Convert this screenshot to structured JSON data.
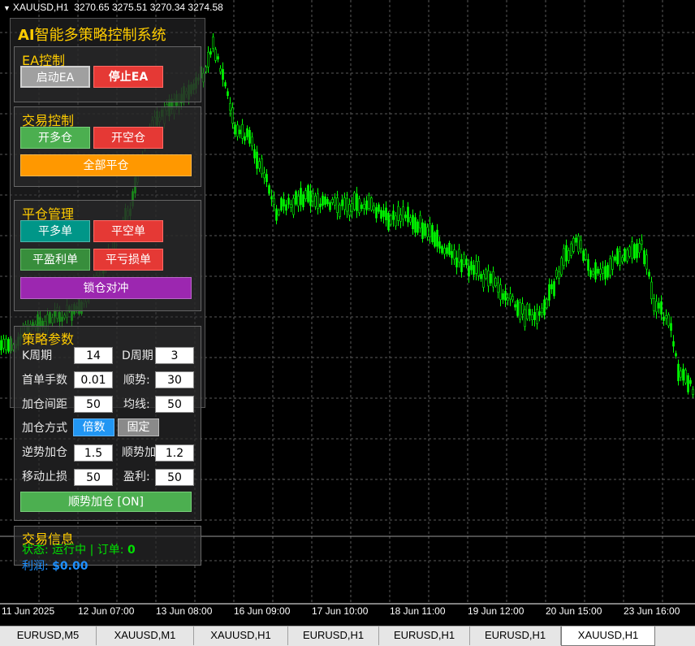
{
  "chart": {
    "symbol": "XAUUSD,H1",
    "ohlc": "3270.65 3275.51 3270.34 3274.58",
    "candle_color": "#00ff00",
    "grid_color": "#5a5a5a",
    "time_labels": [
      "11 Jun 2025",
      "12 Jun 07:00",
      "13 Jun 08:00",
      "16 Jun 09:00",
      "17 Jun 10:00",
      "18 Jun 11:00",
      "19 Jun 12:00",
      "20 Jun 15:00",
      "23 Jun 16:00"
    ]
  },
  "panel": {
    "title_prefix": "AI",
    "title_rest": "智能多策略控制系统",
    "ea_section": {
      "title": "EA控制",
      "start": "启动EA",
      "stop": "停止EA"
    },
    "trade_section": {
      "title": "交易控制",
      "open_long": "开多仓",
      "open_short": "开空仓",
      "close_all": "全部平仓"
    },
    "close_section": {
      "title": "平仓管理",
      "close_long": "平多单",
      "close_short": "平空单",
      "close_profit": "平盈利单",
      "close_loss": "平亏损单",
      "hedge_lock": "锁仓对冲"
    },
    "params_section": {
      "title": "策略参数",
      "k_label": "K周期",
      "k_value": "14",
      "d_label": "D周期",
      "d_value": "3",
      "lot_label": "首单手数",
      "lot_value": "0.01",
      "trend_label": "顺势:",
      "trend_value": "30",
      "spacing_label": "加仓间距",
      "spacing_value": "50",
      "ma_label": "均线:",
      "ma_value": "50",
      "mode_label": "加仓方式",
      "mode_multiple": "倍数",
      "mode_fixed": "固定",
      "counter_label": "逆势加仓",
      "counter_value": "1.5",
      "trend_add_label": "顺势加",
      "trend_add_value": "1.2",
      "trail_label": "移动止损",
      "trail_value": "50",
      "tp_label": "盈利:",
      "tp_value": "50",
      "trend_toggle": "顺势加仓 [ON]"
    },
    "info_section": {
      "title": "交易信息",
      "status_label": "状态: 运行中",
      "orders_label": "订单:",
      "orders_value": "0",
      "profit_label": "利润:",
      "profit_value": "$0.00"
    }
  },
  "tabs": [
    "EURUSD,M5",
    "XAUUSD,M1",
    "XAUUSD,H1",
    "EURUSD,H1",
    "EURUSD,H1",
    "EURUSD,H1",
    "XAUUSD,H1"
  ],
  "active_tab": "XAUUSD,H1"
}
